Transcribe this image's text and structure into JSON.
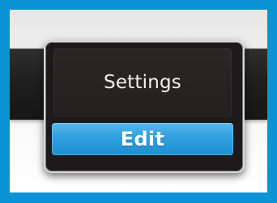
{
  "menu": {
    "items": [
      {
        "label": "Settings",
        "state": "normal"
      },
      {
        "label": "Edit",
        "state": "highlighted"
      }
    ]
  },
  "colors": {
    "border_blue": "#0a94d6",
    "menu_background": "#1c1a1a",
    "highlight_blue": "#2f9fe0",
    "menu_border": "#d7d7d7",
    "text_light": "#f2f2f2"
  }
}
